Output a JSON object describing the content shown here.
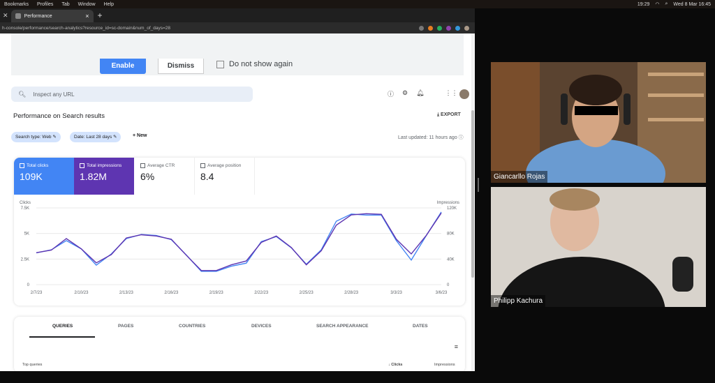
{
  "menubar": {
    "items": [
      "Bookmarks",
      "Profiles",
      "Tab",
      "Window",
      "Help"
    ],
    "clock": "19:29",
    "date": "Wed 8 Mar  16:45"
  },
  "browser": {
    "tab_title": "Performance",
    "url": "h-console/performance/search-analytics?resource_id=sc-domain&num_of_days=28"
  },
  "banner": {
    "enable": "Enable",
    "dismiss": "Dismiss",
    "no_show": "Do not show again"
  },
  "search": {
    "placeholder": "Inspect any URL"
  },
  "page": {
    "title": "Performance on Search results",
    "export": "EXPORT",
    "chip_search_type": "Search type: Web",
    "chip_date": "Date: Last 28 days",
    "new": "New",
    "updated": "Last updated: 11 hours ago"
  },
  "metrics": [
    {
      "label": "Total clicks",
      "value": "109K"
    },
    {
      "label": "Total impressions",
      "value": "1.82M"
    },
    {
      "label": "Average CTR",
      "value": "6%"
    },
    {
      "label": "Average position",
      "value": "8.4"
    }
  ],
  "chart_data": {
    "type": "line",
    "left_axis": {
      "label": "Clicks",
      "ticks": [
        "7.5K",
        "5K",
        "2.5K",
        "0"
      ],
      "ylim": [
        0,
        7500
      ]
    },
    "right_axis": {
      "label": "Impressions",
      "ticks": [
        "120K",
        "80K",
        "40K",
        "0"
      ],
      "ylim": [
        0,
        120000
      ]
    },
    "x_ticks": [
      "2/7/23",
      "2/10/23",
      "2/13/23",
      "2/16/23",
      "2/19/23",
      "2/22/23",
      "2/25/23",
      "2/28/23",
      "3/3/23",
      "3/6/23"
    ],
    "series": [
      {
        "color": "#4285f4",
        "axis": "left",
        "values": [
          3100,
          3400,
          4300,
          3500,
          1900,
          3000,
          4500,
          4900,
          4800,
          4400,
          2900,
          1300,
          1300,
          1800,
          2100,
          4200,
          4700,
          3600,
          2000,
          3400,
          6200,
          6900,
          6800,
          6800,
          4300,
          2400,
          4800,
          7100
        ]
      },
      {
        "color": "#5e35b1",
        "axis": "right",
        "values": [
          50000,
          54000,
          72000,
          56000,
          34000,
          47000,
          73000,
          78000,
          76000,
          71000,
          46000,
          22000,
          22000,
          31000,
          37000,
          66000,
          76000,
          58000,
          31000,
          53000,
          93000,
          109000,
          111000,
          110000,
          71000,
          48000,
          77000,
          112000
        ]
      }
    ]
  },
  "tabs": [
    "QUERIES",
    "PAGES",
    "COUNTRIES",
    "DEVICES",
    "SEARCH APPEARANCE",
    "DATES"
  ],
  "table": {
    "header": "Top queries",
    "clicks": "Clicks",
    "impressions": "Impressions"
  },
  "participants": [
    "Giancarllo Rojas",
    "Philipp Kachura"
  ]
}
